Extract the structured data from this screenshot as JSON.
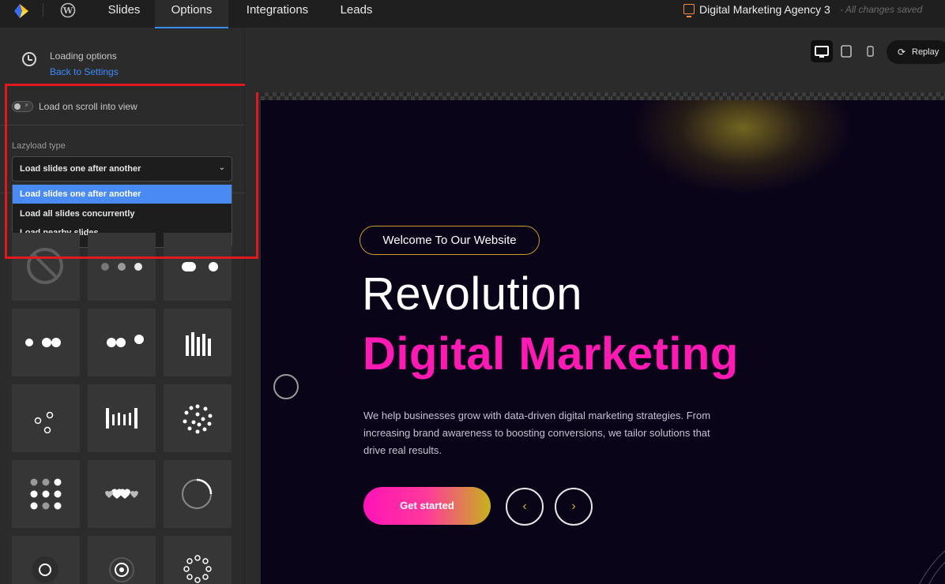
{
  "topbar": {
    "tabs": [
      {
        "label": "Slides",
        "active": false
      },
      {
        "label": "Options",
        "active": true
      },
      {
        "label": "Integrations",
        "active": false
      },
      {
        "label": "Leads",
        "active": false
      }
    ],
    "project_title": "Digital Marketing Agency 3",
    "save_status": "- All changes saved"
  },
  "sidebar": {
    "section_title": "Loading options",
    "back_link": "Back to Settings",
    "scroll_toggle": {
      "label": "Load on scroll into view",
      "on": false
    },
    "lazyload": {
      "label": "Lazyload type",
      "selected": "Load slides one after another",
      "options": [
        "Load slides one after another",
        "Load all slides concurrently",
        "Load nearby slides"
      ]
    },
    "spinner_tiles": [
      "no-spinner-icon",
      "dots-three-fade-icon",
      "dots-pill-icon",
      "dots-pulse-icon",
      "dots-pair-icon",
      "bars-equalizer-icon",
      "dots-triangle-icon",
      "bars-wave-icon",
      "dots-burst-icon",
      "dots-grid-icon",
      "hearts-icon",
      "ring-spinner-icon",
      "ring-small-icon",
      "target-icon",
      "dots-circle-icon"
    ]
  },
  "preview": {
    "devices": [
      "desktop-icon",
      "tablet-icon",
      "mobile-icon"
    ],
    "active_device": "desktop",
    "replay_label": "Replay",
    "slide": {
      "badge": "Welcome To Our Website",
      "heading_line1": "Revolution",
      "heading_line2": "Digital Marketing",
      "paragraph": "We help businesses grow with data-driven digital marketing strategies. From increasing brand awareness to boosting conversions, we tailor solutions that drive real results.",
      "cta_label": "Get started",
      "prev_arrow": "‹",
      "next_arrow": "›"
    }
  },
  "colors": {
    "accent_blue": "#3a8cf5",
    "highlight_red": "#e0191f",
    "pink": "#ff1ab3",
    "gold": "#c99a2e"
  }
}
